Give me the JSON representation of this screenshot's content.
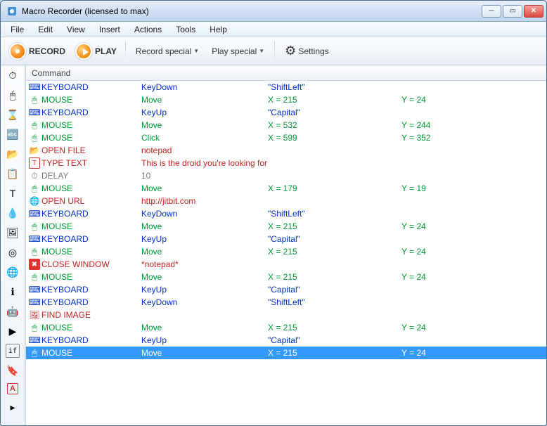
{
  "window": {
    "title": "Macro Recorder (licensed to max)"
  },
  "menu": [
    "File",
    "Edit",
    "View",
    "Insert",
    "Actions",
    "Tools",
    "Help"
  ],
  "toolbar": {
    "record": "RECORD",
    "play": "PLAY",
    "record_special": "Record special",
    "play_special": "Play special",
    "settings": "Settings"
  },
  "grid_header": "Command",
  "sidebar_icons": [
    "stopwatch-icon",
    "mouse-icon",
    "hourglass-icon",
    "text-icon",
    "open-file-icon",
    "copy-icon",
    "typetext-icon",
    "color-picker-icon",
    "image-icon",
    "target-icon",
    "globe-icon",
    "info-icon",
    "android-icon",
    "play-icon",
    "if-icon",
    "label-icon",
    "annotate-icon",
    "collapse-icon"
  ],
  "rows": [
    {
      "icon": "⌨",
      "cmd": "KEYBOARD",
      "col": "color-blue",
      "action": "KeyDown",
      "p1": "\"ShiftLeft\"",
      "p2": ""
    },
    {
      "icon": "🖱",
      "cmd": "MOUSE",
      "col": "color-green",
      "action": "Move",
      "p1": "X = 215",
      "p2": "Y = 24"
    },
    {
      "icon": "⌨",
      "cmd": "KEYBOARD",
      "col": "color-blue",
      "action": "KeyUp",
      "p1": "\"Capital\"",
      "p2": ""
    },
    {
      "icon": "🖱",
      "cmd": "MOUSE",
      "col": "color-green",
      "action": "Move",
      "p1": "X = 532",
      "p2": "Y = 244"
    },
    {
      "icon": "🖱",
      "cmd": "MOUSE",
      "col": "color-green",
      "action": "Click",
      "p1": "X = 599",
      "p2": "Y = 352"
    },
    {
      "icon": "📂",
      "cmd": "OPEN FILE",
      "col": "color-red",
      "action": "notepad",
      "p1": "",
      "p2": ""
    },
    {
      "icon": "T",
      "cmd": "TYPE TEXT",
      "col": "color-red",
      "action": "This is the droid you're looking for!",
      "p1": "",
      "p2": ""
    },
    {
      "icon": "⏱",
      "cmd": "DELAY",
      "col": "color-gray",
      "action": "10",
      "p1": "",
      "p2": ""
    },
    {
      "icon": "🖱",
      "cmd": "MOUSE",
      "col": "color-green",
      "action": "Move",
      "p1": "X = 179",
      "p2": "Y = 19"
    },
    {
      "icon": "🌐",
      "cmd": "OPEN URL",
      "col": "color-red",
      "action": "http://jitbit.com",
      "p1": "",
      "p2": ""
    },
    {
      "icon": "⌨",
      "cmd": "KEYBOARD",
      "col": "color-blue",
      "action": "KeyDown",
      "p1": "\"ShiftLeft\"",
      "p2": ""
    },
    {
      "icon": "🖱",
      "cmd": "MOUSE",
      "col": "color-green",
      "action": "Move",
      "p1": "X = 215",
      "p2": "Y = 24"
    },
    {
      "icon": "⌨",
      "cmd": "KEYBOARD",
      "col": "color-blue",
      "action": "KeyUp",
      "p1": "\"Capital\"",
      "p2": ""
    },
    {
      "icon": "🖱",
      "cmd": "MOUSE",
      "col": "color-green",
      "action": "Move",
      "p1": "X = 215",
      "p2": "Y = 24"
    },
    {
      "icon": "✖",
      "cmd": "CLOSE WINDOW",
      "col": "color-red",
      "action": "*notepad*",
      "p1": "",
      "p2": ""
    },
    {
      "icon": "🖱",
      "cmd": "MOUSE",
      "col": "color-green",
      "action": "Move",
      "p1": "X = 215",
      "p2": "Y = 24"
    },
    {
      "icon": "⌨",
      "cmd": "KEYBOARD",
      "col": "color-blue",
      "action": "KeyUp",
      "p1": "\"Capital\"",
      "p2": ""
    },
    {
      "icon": "⌨",
      "cmd": "KEYBOARD",
      "col": "color-blue",
      "action": "KeyDown",
      "p1": "\"ShiftLeft\"",
      "p2": ""
    },
    {
      "icon": "🖼",
      "cmd": "FIND IMAGE",
      "col": "color-red",
      "action": "",
      "p1": "",
      "p2": ""
    },
    {
      "icon": "🖱",
      "cmd": "MOUSE",
      "col": "color-green",
      "action": "Move",
      "p1": "X = 215",
      "p2": "Y = 24"
    },
    {
      "icon": "⌨",
      "cmd": "KEYBOARD",
      "col": "color-blue",
      "action": "KeyUp",
      "p1": "\"Capital\"",
      "p2": ""
    },
    {
      "icon": "🖱",
      "cmd": "MOUSE",
      "col": "color-green",
      "action": "Move",
      "p1": "X = 215",
      "p2": "Y = 24",
      "selected": true
    }
  ]
}
